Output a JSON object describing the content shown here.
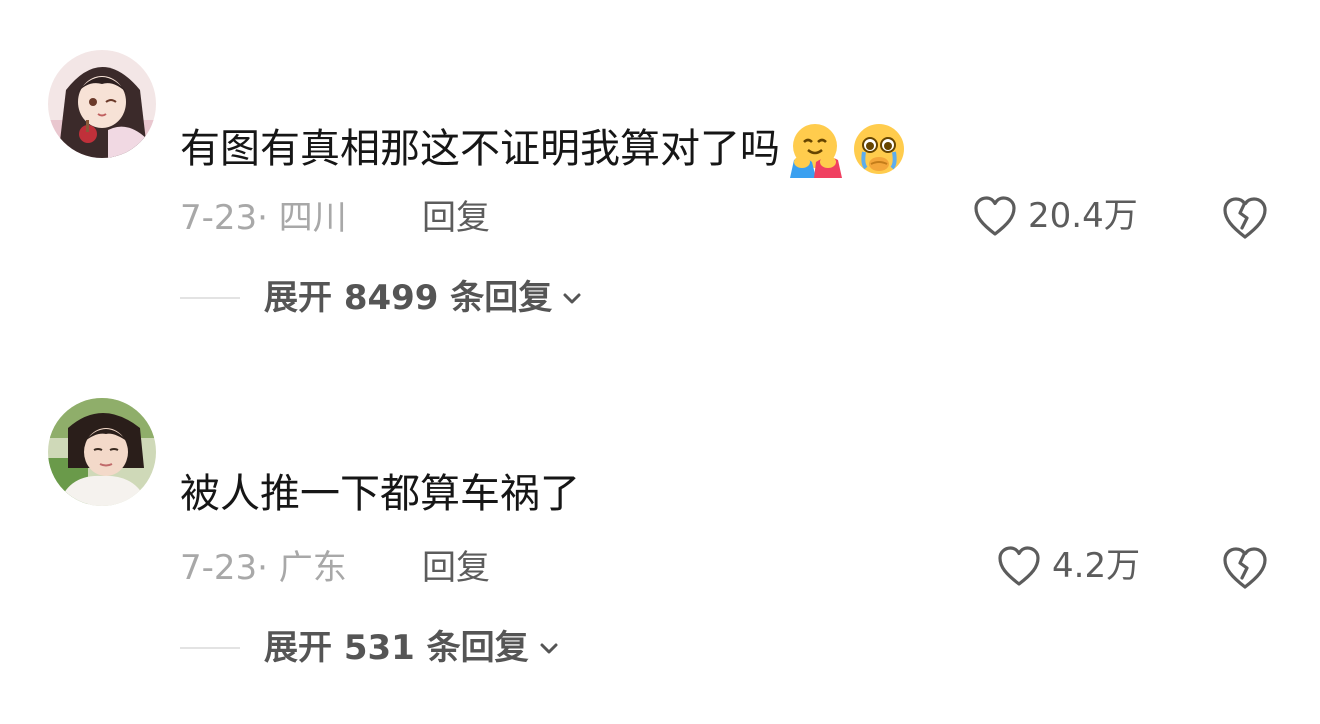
{
  "comments": [
    {
      "avatar": "anime-girl-avatar",
      "text": "有图有真相那这不证明我算对了吗",
      "emojis": [
        "hugging-face-emoji",
        "pleading-crying-face-emoji"
      ],
      "date": "7-23",
      "location": "· 四川",
      "reply_label": "回复",
      "likes": "20.4万",
      "expand_label": "展开 8499 条回复"
    },
    {
      "avatar": "woman-photo-avatar",
      "text": "被人推一下都算车祸了",
      "emojis": [],
      "date": "7-23",
      "location": "· 广东",
      "reply_label": "回复",
      "likes": "4.2万",
      "expand_label": "展开 531 条回复"
    }
  ],
  "icons": {
    "like": "heart-outline-icon",
    "dislike": "broken-heart-icon",
    "expand": "chevron-down-icon"
  },
  "colors": {
    "text": "#161616",
    "meta": "#a8a8a8",
    "secondary": "#5c5c5c"
  }
}
